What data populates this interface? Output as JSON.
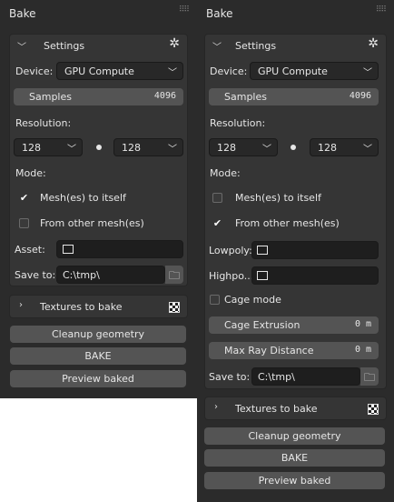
{
  "panels": [
    {
      "title": "Bake",
      "settings_header": "Settings",
      "device_label": "Device:",
      "device_value": "GPU Compute",
      "samples_label": "Samples",
      "samples_value": "4096",
      "resolution_label": "Resolution:",
      "res_x": "128",
      "res_y": "128",
      "mode_label": "Mode:",
      "mode_option_1": "Mesh(es) to itself",
      "mode_option_2": "From other mesh(es)",
      "asset_label": "Asset:",
      "save_label": "Save to:",
      "save_path": "C:\\tmp\\",
      "textures_header": "Textures to bake",
      "cleanup_label": "Cleanup geometry",
      "bake_label": "BAKE",
      "preview_label": "Preview baked",
      "selected_mode": 1
    },
    {
      "title": "Bake",
      "settings_header": "Settings",
      "device_label": "Device:",
      "device_value": "GPU Compute",
      "samples_label": "Samples",
      "samples_value": "4096",
      "resolution_label": "Resolution:",
      "res_x": "128",
      "res_y": "128",
      "mode_label": "Mode:",
      "mode_option_1": "Mesh(es) to itself",
      "mode_option_2": "From other mesh(es)",
      "lowpoly_label": "Lowpoly:",
      "highpoly_label": "Highpo...",
      "cage_mode_label": "Cage mode",
      "cage_extrusion_label": "Cage Extrusion",
      "cage_extrusion_value": "0 m",
      "max_ray_label": "Max Ray Distance",
      "max_ray_value": "0 m",
      "save_label": "Save to:",
      "save_path": "C:\\tmp\\",
      "textures_header": "Textures to bake",
      "cleanup_label": "Cleanup geometry",
      "bake_label": "BAKE",
      "preview_label": "Preview baked",
      "selected_mode": 2
    }
  ]
}
